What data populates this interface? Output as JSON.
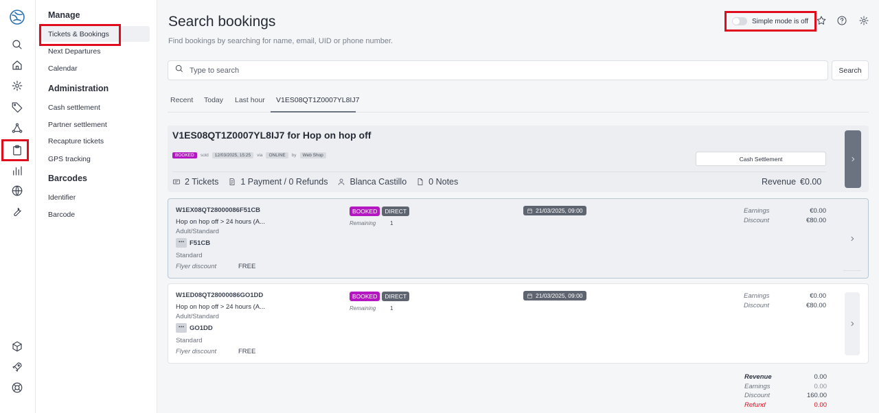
{
  "rail": {
    "items": [
      "logo-icon",
      "search-icon",
      "home-icon",
      "gear-icon",
      "tag-icon",
      "network-icon",
      "clipboard-icon",
      "bar-chart-icon",
      "globe-icon",
      "wrench-icon",
      "cube-icon",
      "rocket-icon",
      "lifebuoy-icon"
    ]
  },
  "subnav": {
    "sections": [
      {
        "title": "Manage",
        "items": [
          "Tickets & Bookings",
          "Next Departures",
          "Calendar"
        ]
      },
      {
        "title": "Administration",
        "items": [
          "Cash settlement",
          "Partner settlement",
          "Recapture tickets",
          "GPS tracking"
        ]
      },
      {
        "title": "Barcodes",
        "items": [
          "Identifier",
          "Barcode"
        ]
      }
    ]
  },
  "header": {
    "title": "Search bookings",
    "subtitle": "Find bookings by searching for name, email, UID or phone number.",
    "simple_mode_label": "Simple mode is off"
  },
  "search": {
    "placeholder": "Type to search",
    "button_label": "Search"
  },
  "tabs": [
    "Recent",
    "Today",
    "Last hour",
    "V1ES08QT1Z0007YL8IJ7"
  ],
  "booking": {
    "title": "V1ES08QT1Z0007YL8IJ7 for Hop on hop off",
    "status": "BOOKED",
    "sold_word": "sold",
    "sold_at": "12/03/2025, 15:25",
    "via_word": "via",
    "channel": "ONLINE",
    "by_word": "by",
    "seller": "Web Shop",
    "cash_settlement_label": "Cash Settlement",
    "tickets": "2 Tickets",
    "payments": "1 Payment / 0 Refunds",
    "customer": "Blanca Castillo",
    "notes": "0 Notes",
    "revenue_label": "Revenue",
    "revenue_value": "€0.00"
  },
  "tickets": [
    {
      "code": "W1EX08QT28000086F51CB",
      "name": "Hop on hop off > 24 hours (A...",
      "category": "Adult/Standard",
      "seat_dots": "...",
      "seat": "F51CB",
      "class": "Standard",
      "discount_label": "Flyer discount",
      "discount_value": "FREE",
      "status": "BOOKED",
      "channel": "DIRECT",
      "remaining_label": "Remaining",
      "remaining_value": "1",
      "date": "21/03/2025, 09:00",
      "earnings_label": "Earnings",
      "earnings_value": "€0.00",
      "discount_amount_label": "Discount",
      "discount_amount_value": "€80.00"
    },
    {
      "code": "W1ED08QT28000086GO1DD",
      "name": "Hop on hop off > 24 hours (A...",
      "category": "Adult/Standard",
      "seat_dots": "...",
      "seat": "GO1DD",
      "class": "Standard",
      "discount_label": "Flyer discount",
      "discount_value": "FREE",
      "status": "BOOKED",
      "channel": "DIRECT",
      "remaining_label": "Remaining",
      "remaining_value": "1",
      "date": "21/03/2025, 09:00",
      "earnings_label": "Earnings",
      "earnings_value": "€0.00",
      "discount_amount_label": "Discount",
      "discount_amount_value": "€80.00"
    }
  ],
  "summary": {
    "revenue_label": "Revenue",
    "revenue_value": "0.00",
    "earnings_label": "Earnings",
    "earnings_value": "0.00",
    "discount_label": "Discount",
    "discount_value": "160.00",
    "refund_label": "Refund",
    "refund_value": "0.00"
  },
  "colors": {
    "accent_booked": "#b416c2",
    "highlight_red": "#e00b1c",
    "pill_dark": "#5e6470"
  }
}
